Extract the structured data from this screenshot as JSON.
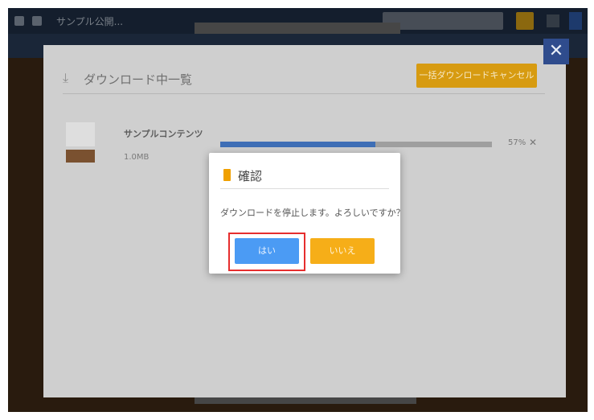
{
  "topbar": {
    "title": "サンプル公開...",
    "colors": {
      "bar": "#1f2f45",
      "accent": "#d6a018",
      "blue_button": "#2d5aa6"
    }
  },
  "download_panel": {
    "title": "ダウンロード中一覧",
    "title_icon": "download-icon",
    "action_label": "一括ダウンロードキャンセル",
    "close_icon": "close-icon",
    "items": [
      {
        "name": "サンプルコンテンツ",
        "size": "1.0MB",
        "progress_fraction": 0.57,
        "progress_text": "57%",
        "cancel_icon": "close-icon"
      }
    ]
  },
  "dialog": {
    "title": "確認",
    "title_icon": "info-bar-icon",
    "message": "ダウンロードを停止します。よろしいですか？",
    "yes_label": "はい",
    "no_label": "いいえ",
    "colors": {
      "yes": "#4b9bf4",
      "no": "#f6ae18",
      "focus_ring": "#e62e2e"
    }
  }
}
